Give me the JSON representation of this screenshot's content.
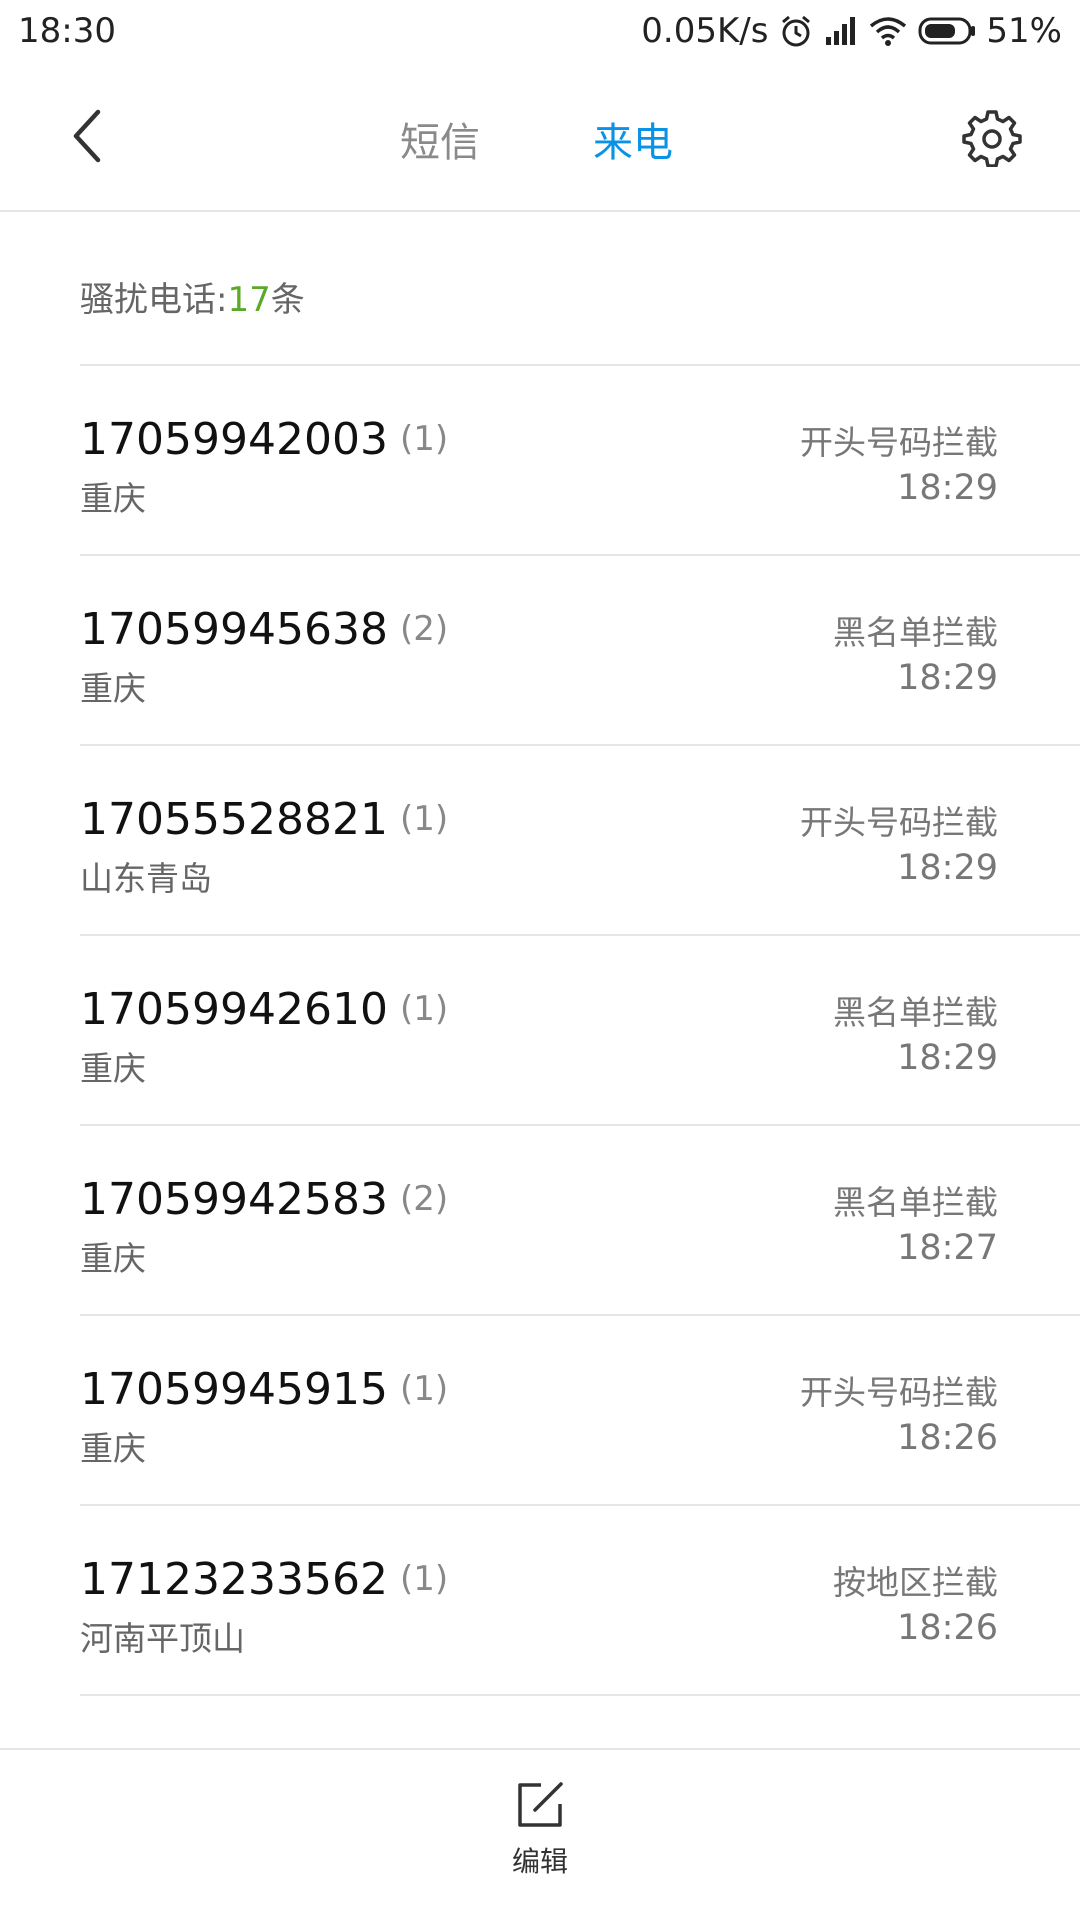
{
  "status_bar": {
    "time": "18:30",
    "network_speed": "0.05K/s",
    "battery": "51%",
    "icons": [
      "alarm-icon",
      "signal-icon",
      "wifi-icon",
      "battery-icon"
    ]
  },
  "header": {
    "tabs": [
      {
        "label": "短信",
        "active": false
      },
      {
        "label": "来电",
        "active": true
      }
    ],
    "icons": [
      "back-icon",
      "gear-icon"
    ]
  },
  "summary": {
    "label": "骚扰电话:",
    "count": "17",
    "unit": "条"
  },
  "calls": [
    {
      "number": "17059942003",
      "count": "(1)",
      "location": "重庆",
      "reason": "开头号码拦截",
      "time": "18:29"
    },
    {
      "number": "17059945638",
      "count": "(2)",
      "location": "重庆",
      "reason": "黑名单拦截",
      "time": "18:29"
    },
    {
      "number": "17055528821",
      "count": "(1)",
      "location": "山东青岛",
      "reason": "开头号码拦截",
      "time": "18:29"
    },
    {
      "number": "17059942610",
      "count": "(1)",
      "location": "重庆",
      "reason": "黑名单拦截",
      "time": "18:29"
    },
    {
      "number": "17059942583",
      "count": "(2)",
      "location": "重庆",
      "reason": "黑名单拦截",
      "time": "18:27"
    },
    {
      "number": "17059945915",
      "count": "(1)",
      "location": "重庆",
      "reason": "开头号码拦截",
      "time": "18:26"
    },
    {
      "number": "17123233562",
      "count": "(1)",
      "location": "河南平顶山",
      "reason": "按地区拦截",
      "time": "18:26"
    }
  ],
  "bottom_bar": {
    "edit_label": "编辑",
    "icon": "edit-icon"
  },
  "colors": {
    "accent": "#0a93e6",
    "count_green": "#5aaa2a"
  }
}
